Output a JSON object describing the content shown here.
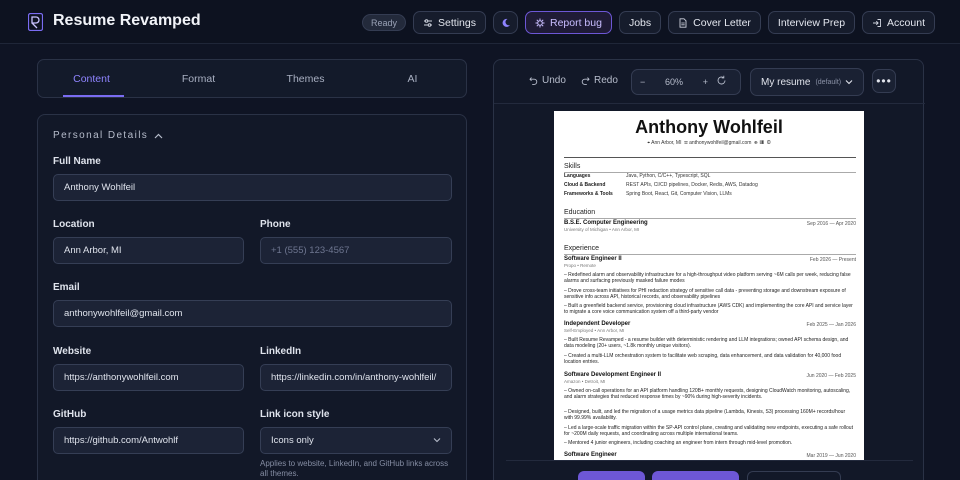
{
  "app": {
    "title": "Resume Revamped",
    "accent": "#7a6cf2"
  },
  "nav": {
    "status": "Ready",
    "settings": "Settings",
    "report_bug": "Report bug",
    "jobs": "Jobs",
    "cover_letter": "Cover Letter",
    "interview_prep": "Interview Prep",
    "account": "Account"
  },
  "tabs": [
    "Content",
    "Format",
    "Themes",
    "AI"
  ],
  "personal": {
    "section": "Personal Details",
    "full_name_label": "Full Name",
    "full_name": "Anthony Wohlfeil",
    "location_label": "Location",
    "location": "Ann Arbor, MI",
    "phone_label": "Phone",
    "phone_placeholder": "+1 (555) 123-4567",
    "email_label": "Email",
    "email": "anthonywohlfeil@gmail.com",
    "website_label": "Website",
    "website": "https://anthonywohlfeil.com",
    "linkedin_label": "LinkedIn",
    "linkedin": "https://linkedin.com/in/anthony-wohlfeil/",
    "github_label": "GitHub",
    "github": "https://github.com/Antwohlf",
    "link_icon_label": "Link icon style",
    "link_icon_value": "Icons only",
    "link_icon_hint": "Applies to website, LinkedIn, and GitHub links across all themes."
  },
  "preview": {
    "undo": "Undo",
    "redo": "Redo",
    "zoom": "60%",
    "resume_name": "My resume",
    "resume_default": "(default)",
    "more": "•••"
  },
  "resume": {
    "name": "Anthony Wohlfeil",
    "location": "Ann Arbor, MI",
    "email": "anthonywohlfeil@gmail.com",
    "skills_title": "Skills",
    "skills": [
      {
        "k": "Languages",
        "v": "Java, Python, C/C++, Typescript, SQL"
      },
      {
        "k": "Cloud & Backend",
        "v": "REST APIs, CI/CD pipelines, Docker, Redis, AWS, Datadog"
      },
      {
        "k": "Frameworks & Tools",
        "v": "Spring Boot, React, Git, Computer Vision, LLMs"
      }
    ],
    "education_title": "Education",
    "degree": "B.S.E. Computer Engineering",
    "school": "University of Michigan • Ann Arbor, MI",
    "edu_dates": "Sep 2016 — Apr 2020",
    "experience_title": "Experience",
    "jobs": [
      {
        "role": "Software Engineer II",
        "dates": "Feb 2026 — Present",
        "sub": "Propo • Remote",
        "b1": "– Redefined alarm and observability infrastructure for a high-throughput video platform serving ~6M calls per week, reducing false alarms and surfacing previously masked failure modes",
        "b2": "– Drove cross-team initiatives for PHI redaction strategy of sensitive call data - preventing storage and downstream exposure of sensitive info across API, historical records, and observability pipelines",
        "b3": "– Built a greenfield backend service, provisioning cloud infrastructure (AWS CDK) and implementing the core API and service layer to migrate a core voice communication system off a third-party vendor"
      },
      {
        "role": "Independent Developer",
        "dates": "Feb 2025 — Jan 2026",
        "sub": "Self-Employed • Ann Arbor, MI",
        "b1": "– Built Resume Revamped - a resume builder with deterministic rendering and LLM integrations; owned API schema design, and data modeling (20+ users, ~1.8k monthly unique visitors).",
        "b2": "– Created a multi-LLM orchestration system to facilitate web scraping, data enhancement, and data validation for 40,000 food location entries."
      },
      {
        "role": "Software Development Engineer II",
        "dates": "Jun 2020 — Feb 2025",
        "sub": "Amazon • Detroit, MI",
        "b1": "– Owned on-call operations for an API platform handling 120B+ monthly requests, designing CloudWatch monitoring, autoscaling, and alarm strategies that reduced response times by ~90% during high-severity incidents.",
        "b2": "– Designed, built, and led the migration of a usage metrics data pipeline (Lambda, Kinesis, S3) processing 160M+ records/hour with 99.99% availability.",
        "b3": "– Led a large-scale traffic migration within the SP-API control plane, creating and validating new endpoints, executing a safe rollout for ~200M daily requests, and coordinating across multiple international teams.",
        "b4": "– Mentored 4 junior engineers, including coaching an engineer from intern through mid-level promotion."
      },
      {
        "role": "Software Engineer",
        "dates": "Mar 2019 — Jun 2020"
      }
    ]
  }
}
